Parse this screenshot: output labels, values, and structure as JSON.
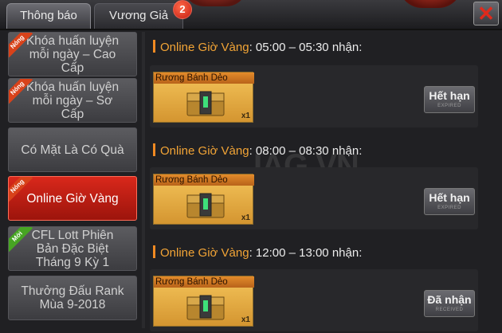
{
  "tabs": [
    {
      "label": "Thông báo"
    },
    {
      "label": "Vương Giả",
      "badge": "2"
    }
  ],
  "close_icon": "close-icon",
  "sidebar": {
    "items": [
      {
        "label": "Khóa huấn luyện\nmỗi ngày – Cao\nCấp",
        "ribbon": "Nóng",
        "ribbon_type": "hot"
      },
      {
        "label": "Khóa huấn luyện\nmỗi ngày – Sơ\nCấp",
        "ribbon": "Nóng",
        "ribbon_type": "hot"
      },
      {
        "label": "Có Mặt Là Có Quà",
        "ribbon": ""
      },
      {
        "label": "Online Giờ Vàng",
        "ribbon": "Nóng",
        "ribbon_type": "hot",
        "active": true
      },
      {
        "label": "CFL Lott Phiên\nBản Đặc Biệt\nTháng 9 Kỳ 1",
        "ribbon": "Mới",
        "ribbon_type": "new"
      },
      {
        "label": "Thưởng Đấu Rank\nMùa 9-2018",
        "ribbon": ""
      }
    ]
  },
  "sections": [
    {
      "title_prefix": "Online Giờ Vàng",
      "title_time": ": 05:00 – 05:30 ",
      "title_suffix": "nhận:",
      "item_name": "Rương Bánh Dẻo",
      "qty": "x1",
      "status": "Hết hạn",
      "status_sub": "EXPIRED"
    },
    {
      "title_prefix": "Online Giờ Vàng",
      "title_time": ": 08:00 – 08:30 ",
      "title_suffix": "nhận:",
      "item_name": "Rương Bánh Dẻo",
      "qty": "x1",
      "status": "Hết hạn",
      "status_sub": "EXPIRED"
    },
    {
      "title_prefix": "Online Giờ Vàng",
      "title_time": ": 12:00 – 13:00 ",
      "title_suffix": "nhận:",
      "item_name": "Rương Bánh Dẻo",
      "qty": "x1",
      "status": "Đã nhận",
      "status_sub": "RECEIVED"
    }
  ],
  "watermark": "IAG.VN",
  "colors": {
    "accent": "#f2a436",
    "active": "#d9281b",
    "hot_ribbon": "#d8421a",
    "new_ribbon": "#47a523"
  }
}
